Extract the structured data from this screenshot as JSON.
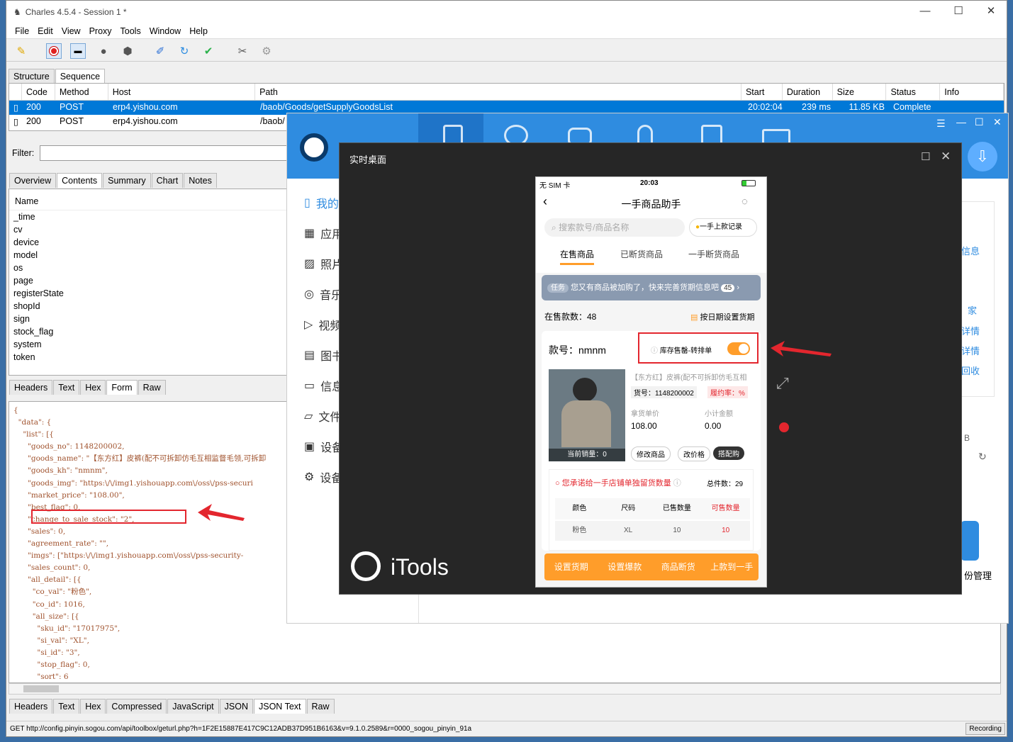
{
  "charles": {
    "title": "Charles 4.5.4 - Session 1 *",
    "window_controls": [
      "—",
      "☐",
      "✕"
    ],
    "menu": [
      "File",
      "Edit",
      "View",
      "Proxy",
      "Tools",
      "Window",
      "Help"
    ],
    "view_tabs": [
      "Structure",
      "Sequence"
    ],
    "columns": [
      "Code",
      "Method",
      "Host",
      "Path",
      "Start",
      "Duration",
      "Size",
      "Status",
      "Info"
    ],
    "rows": [
      {
        "code": "200",
        "method": "POST",
        "host": "erp4.yishou.com",
        "path": "/baob/Goods/getSupplyGoodsList",
        "start": "20:02:04",
        "duration": "239 ms",
        "size": "11.85 KB",
        "status": "Complete",
        "info": ""
      },
      {
        "code": "200",
        "method": "POST",
        "host": "erp4.yishou.com",
        "path": "/baob/",
        "start": "",
        "duration": "",
        "size": "",
        "status": "",
        "info": ""
      }
    ],
    "filter_label": "Filter:",
    "detail_tabs": [
      "Overview",
      "Contents",
      "Summary",
      "Chart",
      "Notes"
    ],
    "name_header": "Name",
    "names": [
      "_time",
      "cv",
      "device",
      "model",
      "os",
      "page",
      "registerState",
      "shopId",
      "sign",
      "stock_flag",
      "system",
      "token"
    ],
    "req_tabs": [
      "Headers",
      "Text",
      "Hex",
      "Form",
      "Raw"
    ],
    "json_lines": [
      "{",
      "  \"data\": {",
      "    \"list\": [{",
      "      \"goods_no\": 1148200002,",
      "      \"goods_name\": \"【东方红】皮裤(配不可拆卸仿毛互相监督毛领,可拆卸",
      "      \"goods_kh\": \"nmnm\",",
      "      \"goods_img\": \"https:\\/\\/img1.yishouapp.com\\/oss\\/pss-securi",
      "      \"market_price\": \"108.00\",",
      "      \"best_flag\": 0,",
      "      \"change_to_sale_stock\": \"2\",",
      "      \"sales\": 0,",
      "      \"agreement_rate\": \"\",",
      "      \"imgs\": [\"https:\\/\\/img1.yishouapp.com\\/oss\\/pss-security-",
      "      \"sales_count\": 0,",
      "      \"all_detail\": [{",
      "        \"co_val\": \"粉色\",",
      "        \"co_id\": 1016,",
      "        \"all_size\": [{",
      "          \"sku_id\": \"17017975\",",
      "          \"si_val\": \"XL\",",
      "          \"si_id\": \"3\",",
      "          \"stop_flag\": 0,",
      "          \"sort\": 6"
    ],
    "resp_tabs": [
      "Headers",
      "Text",
      "Hex",
      "Compressed",
      "JavaScript",
      "JSON",
      "JSON Text",
      "Raw"
    ],
    "status_text": "GET http://config.pinyin.sogou.com/api/toolbox/geturl.php?h=1F2E15887E417C9C12ADB37D951B6163&v=9.1.0.2589&r=0000_sogou_pinyin_91a",
    "recording": "Recording"
  },
  "itools": {
    "sidebar": [
      "我的",
      "应用",
      "照片",
      "音乐",
      "视频",
      "图书",
      "信息",
      "文件",
      "设备",
      "设备"
    ],
    "right_fragments": [
      "信息",
      "家",
      "详情",
      "详情",
      "回收",
      "B",
      "份管理"
    ],
    "logo_text": "iTools"
  },
  "realtime": {
    "title": "实时桌面",
    "phone": {
      "carrier": "无 SIM 卡",
      "time": "20:03",
      "page_title": "一手商品助手",
      "search_placeholder": "搜索款号/商品名称",
      "record_btn": "一手上款记录",
      "tabs": [
        "在售商品",
        "已断货商品",
        "一手断货商品"
      ],
      "banner_tag": "任务",
      "banner_text": "您又有商品被加购了，快来完善货期信息吧",
      "banner_count": "45",
      "on_sale_count": "在售款数：48",
      "set_date": "按日期设置货期",
      "style_no": "款号：nmnm",
      "stock_toggle": "库存售罄-转排单",
      "goods_name": "【东方红】皮裤(配不可拆卸仿毛互相",
      "goods_no": "货号：1148200002",
      "agreement": "履约率：%",
      "price_label": "拿货单价",
      "price": "108.00",
      "subtotal_label": "小计金额",
      "subtotal": "0.00",
      "current_sales": "当前销量：0",
      "actions": [
        "修改商品",
        "改价格",
        "搭配购"
      ],
      "promise_text": "您承诺给一手店铺单独留货数量",
      "total": "总件数：29",
      "table_headers": [
        "颜色",
        "尺码",
        "已售数量",
        "可售数量"
      ],
      "table_row": [
        "粉色",
        "XL",
        "10",
        "10"
      ],
      "bottom_buttons": [
        "设置货期",
        "设置爆款",
        "商品断货",
        "上款到一手"
      ]
    }
  }
}
